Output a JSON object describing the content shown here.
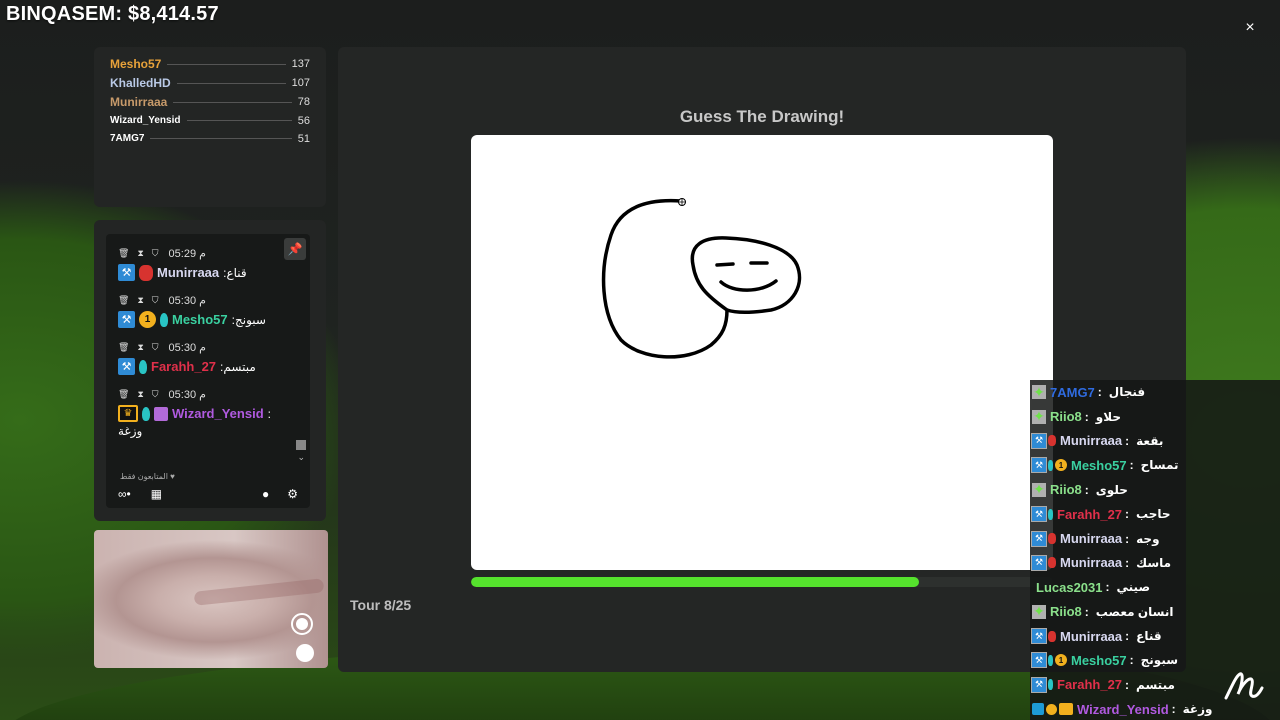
{
  "header": {
    "title": "BINQASEM: $8,414.57",
    "close_label": "×"
  },
  "leaderboard": [
    {
      "name": "Mesho57",
      "score": "137",
      "color": "#e8a23a"
    },
    {
      "name": "KhalledHD",
      "score": "107",
      "color": "#b9c9e6"
    },
    {
      "name": "Munirraaa",
      "score": "78",
      "color": "#c79a6a"
    },
    {
      "name": "Wizard_Yensid",
      "score": "56",
      "color": "#ffffff"
    },
    {
      "name": "7AMG7",
      "score": "51",
      "color": "#ffffff"
    }
  ],
  "chat": {
    "pin_icon": "pin-icon",
    "messages": [
      {
        "time": "05:29 م",
        "user": "Munirraaa",
        "color": "#d8d8f0",
        "text": ":قناع"
      },
      {
        "time": "05:30 م",
        "user": "Mesho57",
        "color": "#3ad0a0",
        "text": ":سبونج"
      },
      {
        "time": "05:30 م",
        "user": "Farahh_27",
        "color": "#e0304a",
        "text": ":مبتسم"
      },
      {
        "time": "05:30 م",
        "user": "Wizard_Yensid",
        "color": "#b05ae0",
        "text": ":",
        "text2": "وزغة"
      }
    ],
    "coin_label": "1",
    "followers_note": "المتابعون فقط ♥"
  },
  "game": {
    "title": "Guess The Drawing!",
    "tour_label": "Tour 8/25",
    "progress": 0.77,
    "progress_color": "#55e22d"
  },
  "overlay_chat": [
    {
      "badges": [
        "star"
      ],
      "user": "7AMG7",
      "color": "#2f6be0",
      "text": "فنجال"
    },
    {
      "badges": [
        "star"
      ],
      "user": "Riio8",
      "color": "#8be08b",
      "text": "حلاو"
    },
    {
      "badges": [
        "mod",
        "red"
      ],
      "user": "Munirraaa",
      "color": "#d8d8f0",
      "text": "بقعة"
    },
    {
      "badges": [
        "mod",
        "drop",
        "coin"
      ],
      "user": "Mesho57",
      "color": "#3ad0a0",
      "text": "تمساح"
    },
    {
      "badges": [
        "star"
      ],
      "user": "Riio8",
      "color": "#8be08b",
      "text": "حلوى"
    },
    {
      "badges": [
        "mod",
        "drop"
      ],
      "user": "Farahh_27",
      "color": "#e0304a",
      "text": "حاجب"
    },
    {
      "badges": [
        "mod",
        "red"
      ],
      "user": "Munirraaa",
      "color": "#d8d8f0",
      "text": "وجه"
    },
    {
      "badges": [
        "mod",
        "red"
      ],
      "user": "Munirraaa",
      "color": "#d8d8f0",
      "text": "ماسك"
    },
    {
      "badges": [],
      "user": "Lucas2031",
      "color": "#8be08b",
      "text": "صيني"
    },
    {
      "badges": [
        "star"
      ],
      "user": "Riio8",
      "color": "#8be08b",
      "text": "انسان معصب"
    },
    {
      "badges": [
        "mod",
        "red"
      ],
      "user": "Munirraaa",
      "color": "#d8d8f0",
      "text": "قناع"
    },
    {
      "badges": [
        "mod",
        "drop",
        "coin"
      ],
      "user": "Mesho57",
      "color": "#3ad0a0",
      "text": "سبونج"
    },
    {
      "badges": [
        "mod",
        "drop"
      ],
      "user": "Farahh_27",
      "color": "#e0304a",
      "text": "مبتسم"
    },
    {
      "badges": [
        "cube",
        "gear",
        "crown"
      ],
      "user": "Wizard_Yensid",
      "color": "#b05ae0",
      "text": "وزغة"
    }
  ]
}
